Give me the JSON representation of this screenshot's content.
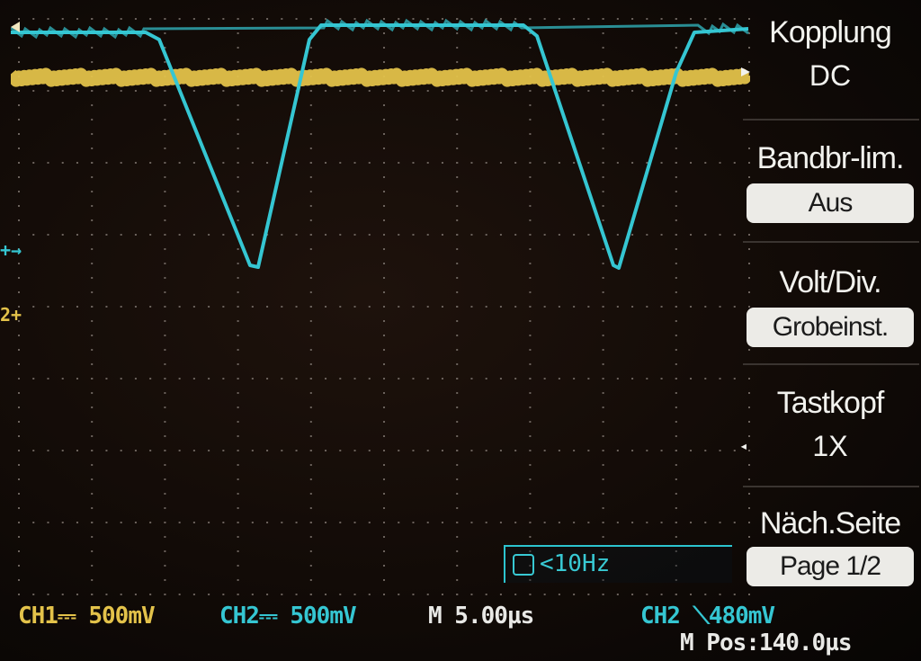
{
  "menu": {
    "kopplung_title": "Kopplung",
    "kopplung_value": "DC",
    "bandbr_title": "Bandbr-lim.",
    "bandbr_value": "Aus",
    "voltdiv_title": "Volt/Div.",
    "voltdiv_value": "Grobeinst.",
    "tastkopf_title": "Tastkopf",
    "tastkopf_value": "1X",
    "naech_title": "Näch.Seite",
    "naech_value": "Page 1/2"
  },
  "trigger": {
    "freq_text": "<10Hz"
  },
  "status": {
    "ch1": "CH1⎓ 500mV",
    "ch2": "CH2⎓ 500mV",
    "timebase": "M 5.00µs",
    "trigger_level": "CH2 ⟍480mV",
    "mpos": "M Pos:140.0µs"
  },
  "colors": {
    "ch1": "#e3c24a",
    "ch2": "#35c6d2",
    "grid": "#6b625c",
    "menu_text": "#f2f2ee"
  },
  "icons": {
    "trigger_icon": "trigger-freq-icon",
    "ch2_marker": "ch2-ground-marker",
    "ch1_marker": "ch1-ground-marker"
  }
}
